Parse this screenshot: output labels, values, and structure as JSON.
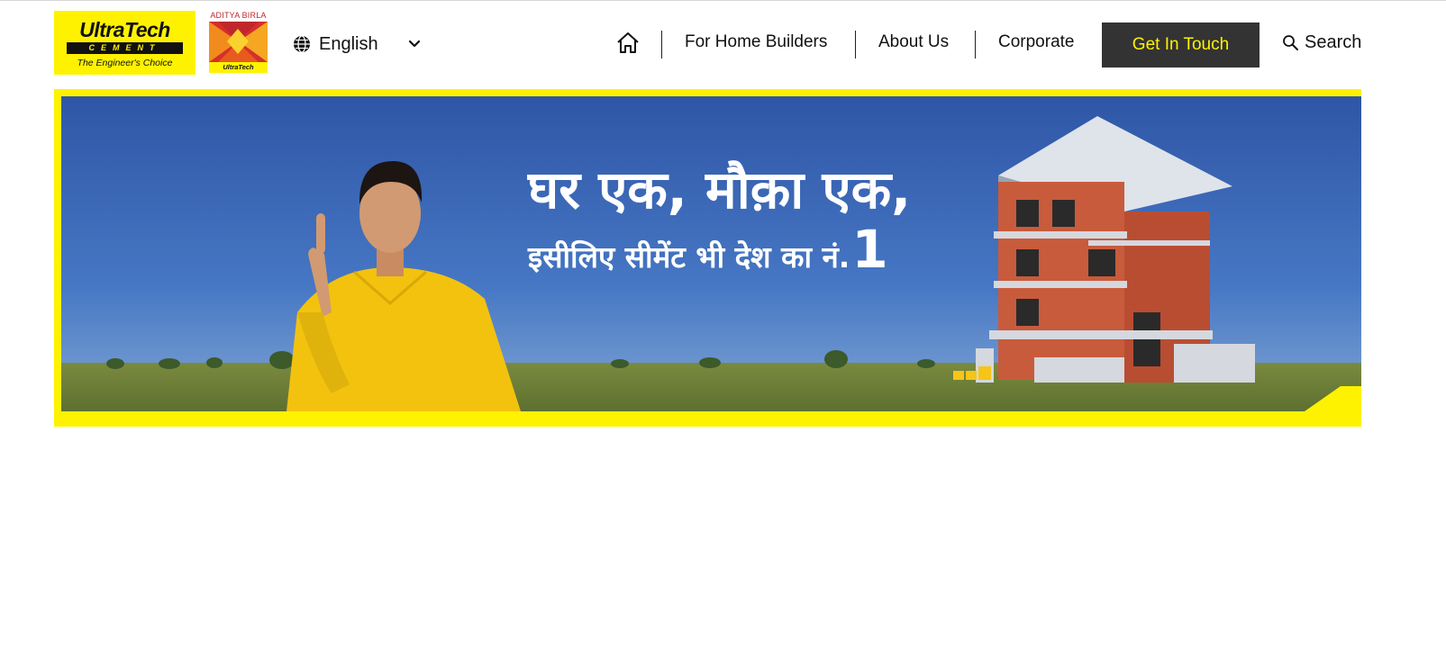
{
  "brand": {
    "logo_word": "UltraTech",
    "logo_bar": "CEMENT",
    "logo_tagline": "The Engineer's Choice",
    "group_name": "ADITYA BIRLA",
    "group_sub": "UltraTech",
    "brand_yellow": "#fff200",
    "dark": "#333333"
  },
  "language": {
    "icon": "globe-icon",
    "selected": "English"
  },
  "nav": {
    "home_icon": "home-icon",
    "items": [
      {
        "label": "For Home Builders"
      },
      {
        "label": "About Us"
      },
      {
        "label": "Corporate"
      }
    ],
    "cta_label": "Get In Touch",
    "search_label": "Search",
    "search_icon": "search-icon"
  },
  "banner": {
    "line1": "घर एक, मौक़ा एक,",
    "line2": "इसीलिए सीमेंट भी देश का नं.",
    "line2_number": "1"
  }
}
